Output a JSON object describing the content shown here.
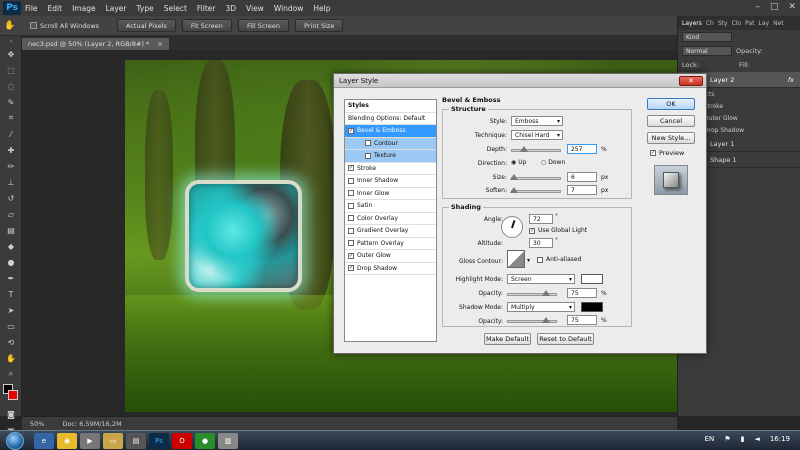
{
  "app": {
    "logo": "Ps"
  },
  "menu": [
    "File",
    "Edit",
    "Image",
    "Layer",
    "Type",
    "Select",
    "Filter",
    "3D",
    "View",
    "Window",
    "Help"
  ],
  "window_controls": [
    "–",
    "□",
    "✕"
  ],
  "options_bar": {
    "scroll_all_label": "Scroll All Windows",
    "buttons": [
      "Actual Pixels",
      "Fit Screen",
      "Fill Screen",
      "Print Size"
    ]
  },
  "document_tab": {
    "label": "nec3.psd @ 50% (Layer 2, RGB/8#) *",
    "close": "×"
  },
  "layers_panel": {
    "tabs": [
      "Layers",
      "Ch",
      "Sty",
      "Clo",
      "Pat",
      "Lay",
      "Net"
    ],
    "kind_label": "Kind",
    "blend_mode": "Normal",
    "opacity_label": "Opacity:",
    "lock_label": "Lock:",
    "fill_label": "Fill:",
    "layers": [
      {
        "name": "Layer 2",
        "fx": "fx",
        "selected": true
      },
      {
        "name": "Layer 1",
        "fx": "",
        "selected": false
      },
      {
        "name": "Shape 1",
        "fx": "",
        "selected": false
      }
    ],
    "effects_label": "Effects",
    "effects": [
      "Stroke",
      "Outer Glow",
      "Drop Shadow"
    ]
  },
  "status_bar": {
    "zoom": "50%",
    "doc": "Doc: 6,59M/16,2M"
  },
  "taskbar": {
    "lang": "EN",
    "time": "16:19"
  },
  "dialog": {
    "title": "Layer Style",
    "close_glyph": "✕",
    "styles_header": "Styles",
    "blending_options": "Blending Options: Default",
    "style_items": [
      {
        "label": "Bevel & Emboss",
        "checked": true,
        "state": "sel"
      },
      {
        "label": "Contour",
        "checked": false,
        "state": "sub"
      },
      {
        "label": "Texture",
        "checked": false,
        "state": "sub"
      },
      {
        "label": "Stroke",
        "checked": true,
        "state": ""
      },
      {
        "label": "Inner Shadow",
        "checked": false,
        "state": ""
      },
      {
        "label": "Inner Glow",
        "checked": false,
        "state": ""
      },
      {
        "label": "Satin",
        "checked": false,
        "state": ""
      },
      {
        "label": "Color Overlay",
        "checked": false,
        "state": ""
      },
      {
        "label": "Gradient Overlay",
        "checked": false,
        "state": ""
      },
      {
        "label": "Pattern Overlay",
        "checked": false,
        "state": ""
      },
      {
        "label": "Outer Glow",
        "checked": true,
        "state": ""
      },
      {
        "label": "Drop Shadow",
        "checked": true,
        "state": ""
      }
    ],
    "section_title": "Bevel & Emboss",
    "structure": {
      "title": "Structure",
      "style_label": "Style:",
      "style_value": "Emboss",
      "technique_label": "Technique:",
      "technique_value": "Chisel Hard",
      "depth_label": "Depth:",
      "depth_value": "257",
      "depth_unit": "%",
      "direction_label": "Direction:",
      "direction_up": "Up",
      "direction_down": "Down",
      "size_label": "Size:",
      "size_value": "6",
      "size_unit": "px",
      "soften_label": "Soften:",
      "soften_value": "7",
      "soften_unit": "px"
    },
    "shading": {
      "title": "Shading",
      "angle_label": "Angle:",
      "angle_value": "72",
      "degree": "°",
      "global_light": "Use Global Light",
      "altitude_label": "Altitude:",
      "altitude_value": "30",
      "gloss_label": "Gloss Contour:",
      "anti_aliased": "Anti-aliased",
      "highlight_label": "Highlight Mode:",
      "highlight_value": "Screen",
      "highlight_color": "#ffffff",
      "opacity_label": "Opacity:",
      "highlight_opacity": "75",
      "pct": "%",
      "shadow_label": "Shadow Mode:",
      "shadow_value": "Multiply",
      "shadow_color": "#000000",
      "shadow_opacity": "75"
    },
    "buttons": {
      "make_default": "Make Default",
      "reset_default": "Reset to Default"
    },
    "side": {
      "ok": "OK",
      "cancel": "Cancel",
      "new_style": "New Style...",
      "preview": "Preview"
    }
  }
}
